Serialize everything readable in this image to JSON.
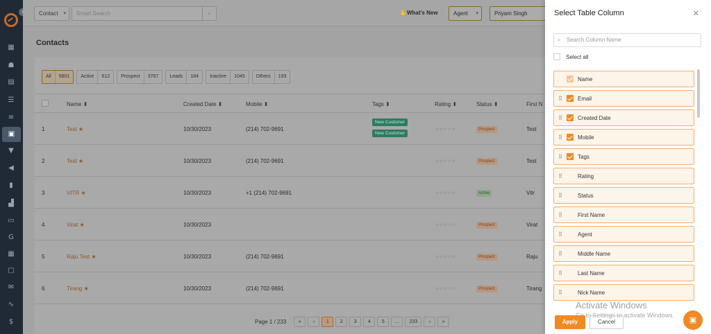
{
  "topbar": {
    "module_select": "Contact",
    "search_placeholder": "Smart Search",
    "whats_new": "What's New",
    "agent_select": "Agent",
    "user_select": "Priyam Singh"
  },
  "page": {
    "title": "Contacts"
  },
  "filters": [
    {
      "label": "All",
      "count": "5801"
    },
    {
      "label": "Active",
      "count": "612"
    },
    {
      "label": "Prospect",
      "count": "3767"
    },
    {
      "label": "Leads",
      "count": "184"
    },
    {
      "label": "Inactive",
      "count": "1045"
    },
    {
      "label": "Others",
      "count": "193"
    }
  ],
  "table": {
    "columns": {
      "name": "Name ⬍",
      "created": "Created Date ⬍",
      "mobile": "Mobile ⬍",
      "tags": "Tags ⬍",
      "rating": "Rating ⬍",
      "status": "Status ⬍",
      "first": "First N"
    },
    "rows": [
      {
        "num": "1",
        "name": "Test",
        "date": "10/30/2023",
        "mobile": "(214) 702-9691",
        "tags": [
          "New Customer",
          "New Customer"
        ],
        "rating": "☆☆☆☆☆",
        "status": "Prospect",
        "first": "Test"
      },
      {
        "num": "2",
        "name": "Test",
        "date": "10/30/2023",
        "mobile": "(214) 702-9691",
        "tags": [],
        "rating": "☆☆☆☆☆",
        "status": "Prospect",
        "first": "Test"
      },
      {
        "num": "3",
        "name": "VITR",
        "date": "10/30/2023",
        "mobile": "+1 (214) 702-9691",
        "tags": [],
        "rating": "☆☆☆☆☆",
        "status": "Active",
        "first": "Vitr"
      },
      {
        "num": "4",
        "name": "Virat",
        "date": "10/30/2023",
        "mobile": "",
        "tags": [],
        "rating": "☆☆☆☆☆",
        "status": "Prospect",
        "first": "Virat"
      },
      {
        "num": "5",
        "name": "Raju Test",
        "date": "10/30/2023",
        "mobile": "(214) 702-9691",
        "tags": [],
        "rating": "☆☆☆☆☆",
        "status": "Prospect",
        "first": "Raju"
      },
      {
        "num": "6",
        "name": "Tirang",
        "date": "10/30/2023",
        "mobile": "(214) 702-9691",
        "tags": [],
        "rating": "☆☆☆☆☆",
        "status": "Prospect",
        "first": "Tirang"
      }
    ]
  },
  "pagination": {
    "label": "Page 1 / 233",
    "pages": [
      "«",
      "‹",
      "1",
      "2",
      "3",
      "4",
      "5",
      "...",
      "233",
      "›",
      "»"
    ]
  },
  "panel": {
    "title": "Select Table Column",
    "search_placeholder": "Search Column Name",
    "select_all": "Select all",
    "columns": [
      {
        "label": "Name",
        "checked": true,
        "locked": true
      },
      {
        "label": "Email",
        "checked": true
      },
      {
        "label": "Created Date",
        "checked": true
      },
      {
        "label": "Mobile",
        "checked": true
      },
      {
        "label": "Tags",
        "checked": true
      },
      {
        "label": "Rating",
        "checked": false
      },
      {
        "label": "Status",
        "checked": false
      },
      {
        "label": "First Name",
        "checked": false
      },
      {
        "label": "Agent",
        "checked": false
      },
      {
        "label": "Middle Name",
        "checked": false
      },
      {
        "label": "Last Name",
        "checked": false
      },
      {
        "label": "Nick Name",
        "checked": false
      }
    ],
    "apply": "Apply",
    "cancel": "Cancel"
  },
  "watermark": {
    "line1": "Activate Windows",
    "line2": "Go to Settings to activate Windows."
  },
  "colors": {
    "accent": "#f08a24",
    "sidebar": "#1f2a36"
  }
}
